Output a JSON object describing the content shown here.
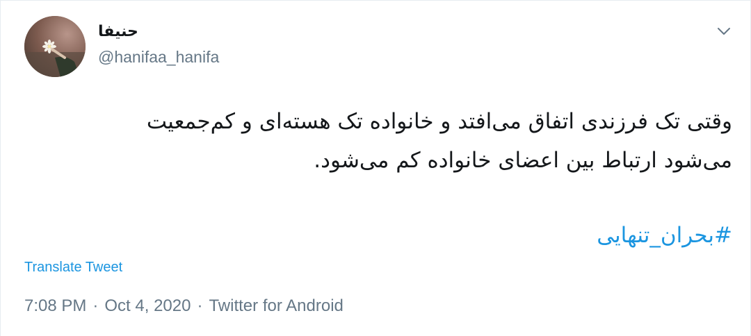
{
  "tweet": {
    "author": {
      "display_name": "حنیفا",
      "handle": "@hanifaa_hanifa"
    },
    "menu_icon": "chevron-down-icon",
    "text_lines": [
      "وقتی تک فرزندی اتفاق می‌افتد و خانواده تک هسته‌ای و کم‌جمعیت",
      "می‌شود ارتباط بین اعضای خانواده کم می‌شود."
    ],
    "hashtag": "#بحران_تنهایی",
    "translate_label": "Translate Tweet",
    "timestamp": {
      "time": "7:08 PM",
      "separator": "·",
      "date": "Oct 4, 2020",
      "source": "Twitter for Android"
    }
  },
  "colors": {
    "link": "#1b95e0",
    "secondary_text": "#657786",
    "primary_text": "#14171a",
    "border": "#e6ecf0"
  }
}
